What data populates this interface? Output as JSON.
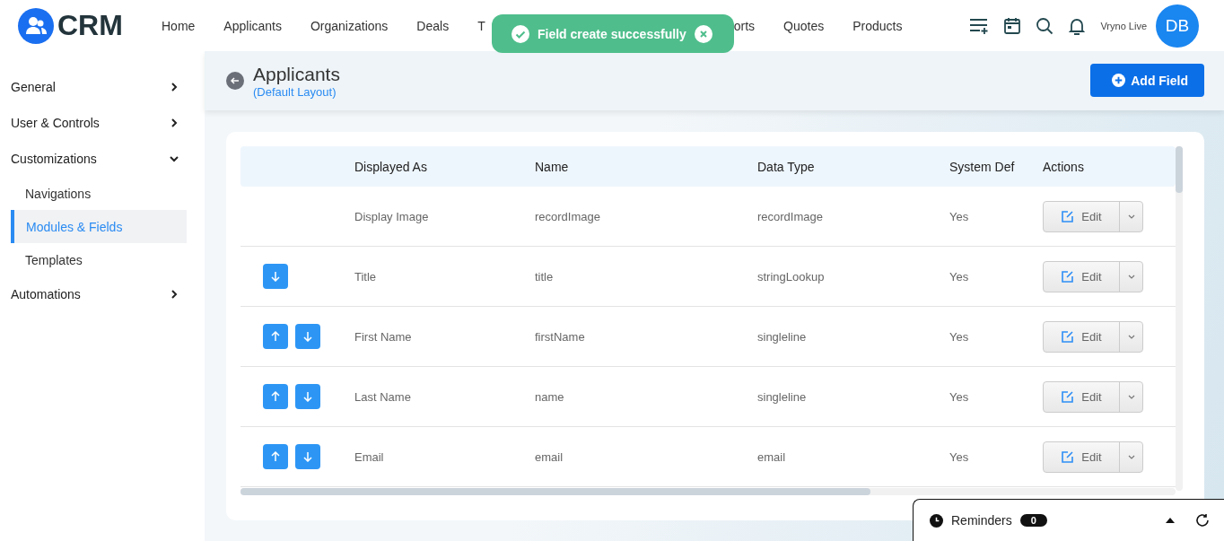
{
  "header": {
    "logo": "CRM",
    "nav": [
      "Home",
      "Applicants",
      "Organizations",
      "Deals",
      "T",
      "orts",
      "Quotes",
      "Products"
    ],
    "user_label": "Vryno Live",
    "avatar": "DB"
  },
  "toast": {
    "message": "Field create successfully"
  },
  "sidebar": {
    "items": [
      {
        "label": "General",
        "expanded": false
      },
      {
        "label": "User & Controls",
        "expanded": false
      },
      {
        "label": "Customizations",
        "expanded": true,
        "children": [
          {
            "label": "Navigations",
            "selected": false
          },
          {
            "label": "Modules & Fields",
            "selected": true
          },
          {
            "label": "Templates",
            "selected": false
          }
        ]
      },
      {
        "label": "Automations",
        "expanded": false
      }
    ]
  },
  "page": {
    "title": "Applicants",
    "subtitle": "(Default Layout)",
    "add_button": "Add Field"
  },
  "table": {
    "columns": [
      "Displayed As",
      "Name",
      "Data Type",
      "System Def",
      "Actions"
    ],
    "rows": [
      {
        "move_up": false,
        "move_down": false,
        "displayed_as": "Display Image",
        "name": "recordImage",
        "data_type": "recordImage",
        "system_def": "Yes",
        "action": "Edit"
      },
      {
        "move_up": false,
        "move_down": true,
        "displayed_as": "Title",
        "name": "title",
        "data_type": "stringLookup",
        "system_def": "Yes",
        "action": "Edit"
      },
      {
        "move_up": true,
        "move_down": true,
        "displayed_as": "First Name",
        "name": "firstName",
        "data_type": "singleline",
        "system_def": "Yes",
        "action": "Edit"
      },
      {
        "move_up": true,
        "move_down": true,
        "displayed_as": "Last Name",
        "name": "name",
        "data_type": "singleline",
        "system_def": "Yes",
        "action": "Edit"
      },
      {
        "move_up": true,
        "move_down": true,
        "displayed_as": "Email",
        "name": "email",
        "data_type": "email",
        "system_def": "Yes",
        "action": "Edit"
      }
    ]
  },
  "reminders": {
    "label": "Reminders",
    "count": "0"
  }
}
